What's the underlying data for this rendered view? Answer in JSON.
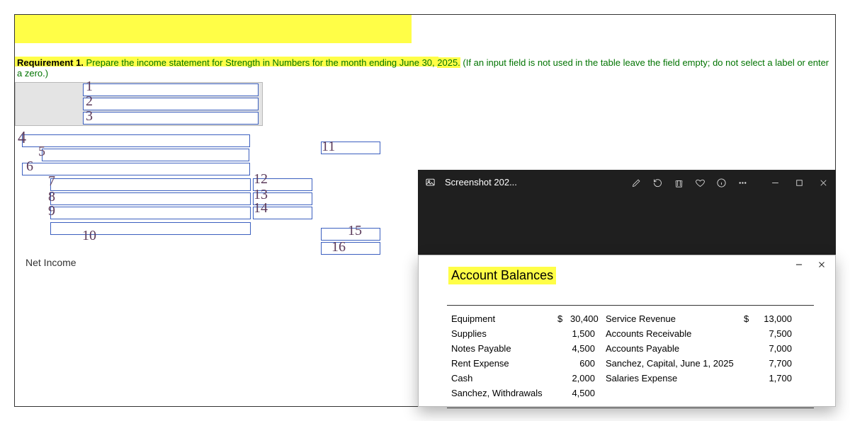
{
  "requirement": {
    "label": "Requirement 1.",
    "part1": " Prepare the income statement for Strength in Numbers for the month ending June 30, ",
    "year": "2025.",
    "note": " (If an input field is not used in the table leave the field empty; do not select a label or enter a zero.)"
  },
  "netincome_label": "Net Income",
  "handwritten": {
    "h1": "1",
    "h2": "2",
    "h3": "3",
    "h4": "4",
    "h5": "5",
    "h6": "6",
    "h7": "7",
    "h8": "8",
    "h9": "9",
    "h10": "10",
    "h11": "11",
    "h12": "12",
    "h13": "13",
    "h14": "14",
    "h15": "15",
    "h16": "16"
  },
  "viewer": {
    "title": "Screenshot 202..."
  },
  "popup": {
    "title": "Account Balances",
    "rows": [
      {
        "l": "Equipment",
        "cur": "$",
        "la": "30,400",
        "r": "Service Revenue",
        "rcur": "$",
        "ra": "13,000"
      },
      {
        "l": "Supplies",
        "cur": "",
        "la": "1,500",
        "r": "Accounts Receivable",
        "rcur": "",
        "ra": "7,500"
      },
      {
        "l": "Notes Payable",
        "cur": "",
        "la": "4,500",
        "r": "Accounts Payable",
        "rcur": "",
        "ra": "7,000"
      },
      {
        "l": "Rent Expense",
        "cur": "",
        "la": "600",
        "r": "Sanchez, Capital, June 1, 2025",
        "rcur": "",
        "ra": "7,700"
      },
      {
        "l": "Cash",
        "cur": "",
        "la": "2,000",
        "r": "Salaries Expense",
        "rcur": "",
        "ra": "1,700"
      },
      {
        "l": "Sanchez, Withdrawals",
        "cur": "",
        "la": "4,500",
        "r": "",
        "rcur": "",
        "ra": ""
      }
    ]
  }
}
